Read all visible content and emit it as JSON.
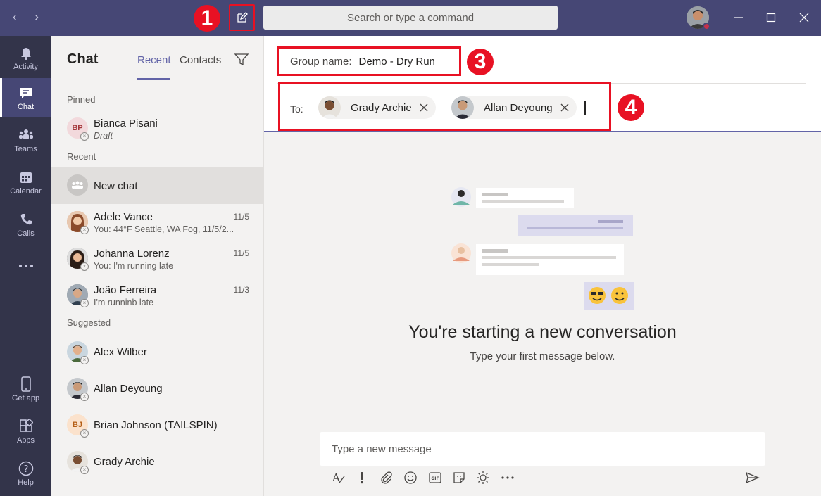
{
  "titlebar": {
    "search_placeholder": "Search or type a command"
  },
  "callouts": [
    "1",
    "3",
    "4"
  ],
  "appbar": {
    "items": [
      {
        "label": "Activity",
        "icon": "bell-icon"
      },
      {
        "label": "Chat",
        "icon": "chat-icon",
        "active": true
      },
      {
        "label": "Teams",
        "icon": "teams-icon"
      },
      {
        "label": "Calendar",
        "icon": "calendar-icon"
      },
      {
        "label": "Calls",
        "icon": "phone-icon"
      },
      {
        "label": "Get app",
        "icon": "phone-device-icon"
      },
      {
        "label": "Apps",
        "icon": "apps-icon"
      },
      {
        "label": "Help",
        "icon": "help-icon"
      }
    ]
  },
  "chat_list": {
    "title": "Chat",
    "tabs": [
      "Recent",
      "Contacts"
    ],
    "sections": {
      "pinned": "Pinned",
      "recent": "Recent",
      "suggested": "Suggested"
    },
    "pinned": [
      {
        "name": "Bianca Pisani",
        "sub": "Draft",
        "initials": "BP"
      }
    ],
    "new_chat": "New chat",
    "recent": [
      {
        "name": "Adele Vance",
        "sub": "You: 44°F Seattle, WA Fog, 11/5/2...",
        "date": "11/5"
      },
      {
        "name": "Johanna Lorenz",
        "sub": "You: I'm running late",
        "date": "11/5"
      },
      {
        "name": "João Ferreira",
        "sub": "I'm runninb late",
        "date": "11/3"
      }
    ],
    "suggested": [
      {
        "name": "Alex Wilber"
      },
      {
        "name": "Allan Deyoung"
      },
      {
        "name": "Brian Johnson (TAILSPIN)",
        "initials": "BJ"
      },
      {
        "name": "Grady Archie"
      }
    ]
  },
  "conversation": {
    "group_name_label": "Group name:",
    "group_name_value": "Demo - Dry Run",
    "to_label": "To:",
    "recipients": [
      "Grady Archie",
      "Allan Deyoung"
    ],
    "empty_title": "You're starting a new conversation",
    "empty_subtitle": "Type your first message below.",
    "composer_placeholder": "Type a new message"
  },
  "colors": {
    "titlebar": "#464775",
    "appbar": "#33344a",
    "accent": "#6264a7",
    "callout": "#e81123"
  }
}
